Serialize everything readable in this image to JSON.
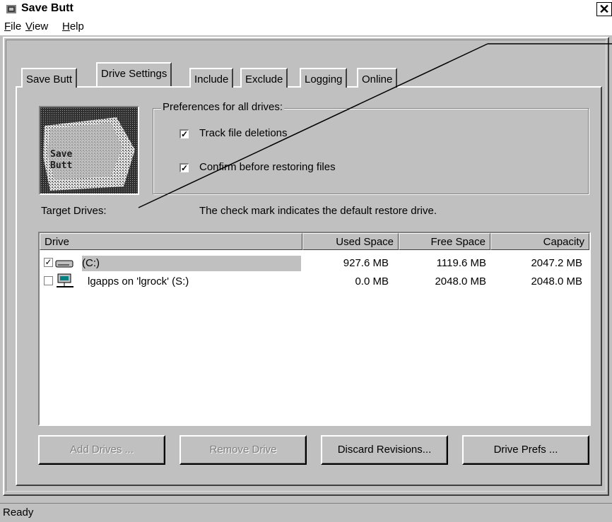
{
  "window": {
    "title": "Save Butt",
    "close_glyph": "✕"
  },
  "menu": [
    {
      "label": "File",
      "accel": "F",
      "rest": "ile"
    },
    {
      "label": "View",
      "accel": "V",
      "rest": "iew"
    },
    {
      "label": "Help",
      "accel": "H",
      "rest": "elp"
    }
  ],
  "tabs": [
    {
      "label": "Save Butt",
      "active": false
    },
    {
      "label": "Drive Settings",
      "active": true
    },
    {
      "label": "Include",
      "active": false
    },
    {
      "label": "Exclude",
      "active": false
    },
    {
      "label": "Logging",
      "active": false
    },
    {
      "label": "Online",
      "active": false
    }
  ],
  "logo": {
    "line1": "Save",
    "line2": "Butt",
    "icon": "save-butt-image"
  },
  "preferences": {
    "legend": "Preferences for all drives:",
    "track_deletions": {
      "label": "Track file deletions",
      "checked": true
    },
    "confirm_restore": {
      "label": "Confirm before restoring files",
      "checked": true
    }
  },
  "target": {
    "label": "Target Drives:",
    "hint": "The check mark indicates the default restore drive."
  },
  "list": {
    "columns": [
      "Drive",
      "Used Space",
      "Free Space",
      "Capacity"
    ],
    "rows": [
      {
        "checked": true,
        "icon": "hard-drive-icon",
        "drive": "(C:)",
        "used": "927.6 MB",
        "free": "1119.6 MB",
        "capacity": "2047.2 MB",
        "selected": true
      },
      {
        "checked": false,
        "icon": "network-drive-icon",
        "drive": "lgapps on 'lgrock' (S:)",
        "used": "0.0 MB",
        "free": "2048.0 MB",
        "capacity": "2048.0 MB",
        "selected": false
      }
    ]
  },
  "buttons": {
    "add_drives": "Add Drives ...",
    "remove_drive": "Remove Drive",
    "discard_revisions": "Discard Revisions...",
    "drive_prefs": "Drive Prefs ..."
  },
  "status": "Ready",
  "colors": {
    "face": "#c0c0c0",
    "shadow": "#808080",
    "selection": "#c0c0c0"
  }
}
